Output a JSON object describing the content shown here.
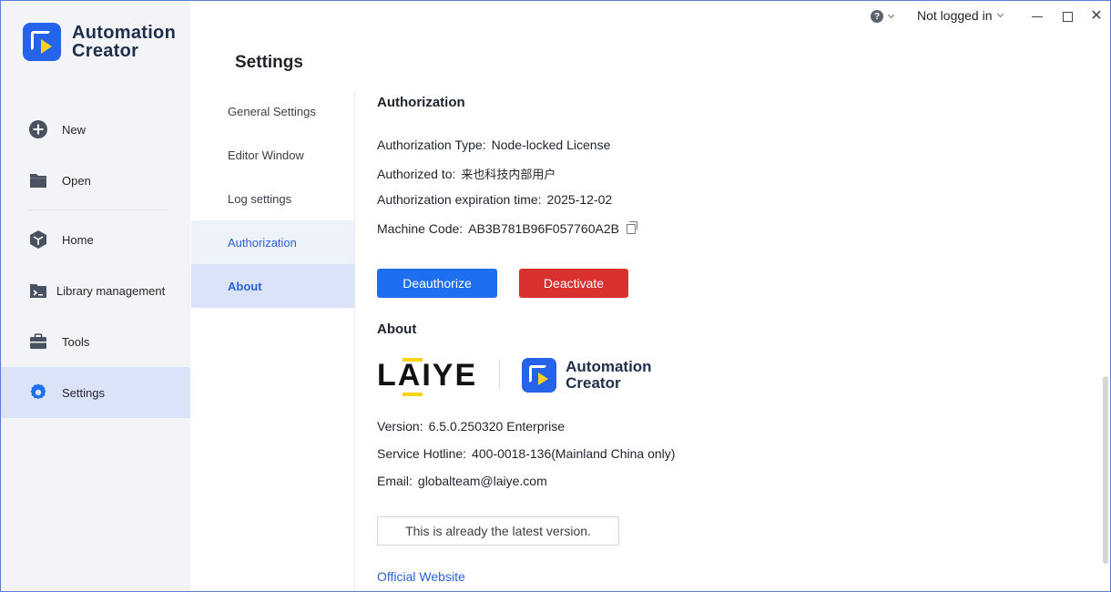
{
  "app": {
    "name_line1": "Automation",
    "name_line2": "Creator"
  },
  "sidebar": {
    "items": [
      {
        "label": "New",
        "icon": "plus-circle-icon"
      },
      {
        "label": "Open",
        "icon": "folder-icon"
      },
      {
        "label": "Home",
        "icon": "cube-icon"
      },
      {
        "label": "Library management",
        "icon": "terminal-folder-icon"
      },
      {
        "label": "Tools",
        "icon": "toolbox-icon"
      },
      {
        "label": "Settings",
        "icon": "gear-icon"
      }
    ]
  },
  "titlebar": {
    "help_icon": "?",
    "user": "Not logged in"
  },
  "settings": {
    "title": "Settings",
    "subnav": [
      "General Settings",
      "Editor Window",
      "Log settings",
      "Authorization",
      "About"
    ]
  },
  "authorization": {
    "title": "Authorization",
    "type_label": "Authorization Type:",
    "type_value": "Node-locked License",
    "to_label": "Authorized to:",
    "to_value": "来也科技内部用户",
    "expire_label": "Authorization expiration time:",
    "expire_value": "2025-12-02",
    "machine_label": "Machine Code:",
    "machine_value": "AB3B781B96F057760A2B",
    "deauthorize": "Deauthorize",
    "deactivate": "Deactivate"
  },
  "about": {
    "title": "About",
    "laiye_logo": "LAIYE",
    "product_line1": "Automation",
    "product_line2": "Creator",
    "version_label": "Version:",
    "version_value": "6.5.0.250320 Enterprise",
    "hotline_label": "Service Hotline:",
    "hotline_value": "400-0018-136(Mainland China only)",
    "email_label": "Email:",
    "email_value": "globalteam@laiye.com",
    "latest": "This is already the latest version.",
    "website": "Official Website"
  },
  "colors": {
    "primary": "#1e6ef0",
    "danger": "#d93030",
    "active_bg": "#dbe3f8",
    "link": "#2b61d6"
  }
}
